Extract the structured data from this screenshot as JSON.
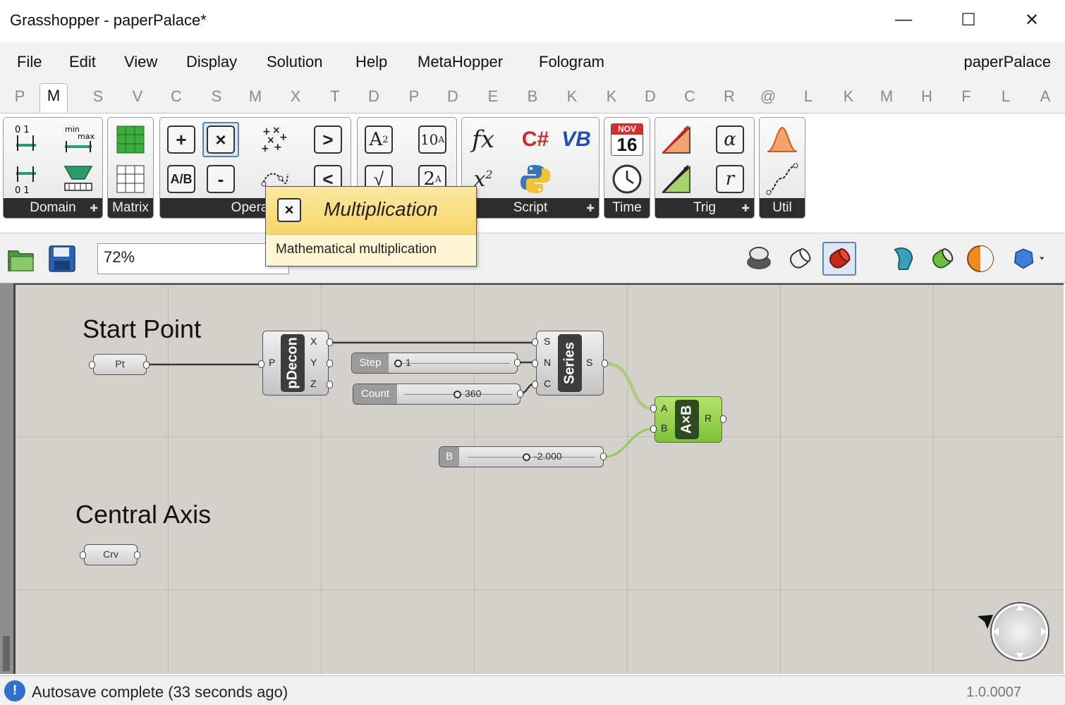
{
  "window": {
    "title": "Grasshopper - paperPalace*",
    "minimize": "—",
    "maximize": "☐",
    "close": "✕"
  },
  "menu": {
    "items": [
      "File",
      "Edit",
      "View",
      "Display",
      "Solution",
      "Help",
      "MetaHopper",
      "Fologram"
    ],
    "document": "paperPalace"
  },
  "tabs": [
    "P",
    "M",
    "S",
    "V",
    "C",
    "S",
    "M",
    "X",
    "T",
    "D",
    "P",
    "D",
    "E",
    "B",
    "K",
    "K",
    "D",
    "C",
    "R",
    "@",
    "L",
    "K",
    "M",
    "H",
    "F",
    "L",
    "A"
  ],
  "active_tab": "M",
  "ribbon": {
    "panels": [
      "Domain",
      "Matrix",
      "Operators",
      "Script",
      "Time",
      "Trig",
      "Util"
    ],
    "panel_labels_visible": [
      "Domain",
      "Matrix",
      "Operato",
      "Script",
      "Time",
      "Trig",
      "Util"
    ],
    "domain_icons": {
      "a": "0 1",
      "b": "min max",
      "c": "0 1"
    },
    "script_icons": {
      "fx": "fx",
      "x2": "x",
      "x2sup": "2",
      "cs": "C#",
      "vb": "VB"
    },
    "time_icons": {
      "month": "NOV",
      "day": "16"
    },
    "operators_icons": {
      "add": "+",
      "mul": "×",
      "div": "A/B",
      "sub": "-",
      "gt": ">",
      "lt": "<",
      "pow": "A",
      "sqrt": "√",
      "pow10": "10",
      "pow2": "2"
    },
    "trig_icons": {
      "alpha": "α",
      "r": "r"
    }
  },
  "tooltip": {
    "name": "Multiplication",
    "description": "Mathematical multiplication",
    "icon": "×"
  },
  "toolbar": {
    "zoom": "72%",
    "icons": [
      "open-icon",
      "save-icon",
      "preview-off-icon",
      "wireframe-icon",
      "shaded-icon",
      "preview-selected-icon",
      "doc-preview-icon",
      "material-icon",
      "sphere-icon"
    ]
  },
  "canvas": {
    "groups": [
      "Start Point",
      "Central Axis"
    ],
    "components": {
      "pt": {
        "label": "Pt"
      },
      "crv": {
        "label": "Crv"
      },
      "pdecon": {
        "name": "pDecon",
        "input": "P",
        "outputs": [
          "X",
          "Y",
          "Z"
        ]
      },
      "series": {
        "name": "Series",
        "inputs": [
          "S",
          "N",
          "C"
        ],
        "output": "S"
      },
      "multiply": {
        "name": "A×B",
        "inputs": [
          "A",
          "B"
        ],
        "output": "R"
      }
    },
    "sliders": [
      {
        "name": "Step",
        "value": "1"
      },
      {
        "name": "Count",
        "value": "360"
      },
      {
        "name": "B",
        "value": "-2.000"
      }
    ]
  },
  "status": {
    "message": "Autosave complete (33 seconds ago)",
    "version": "1.0.0007",
    "icon": "info-icon"
  },
  "colors": {
    "canvas": "#d4d1cc",
    "selected_component": "#8bc840",
    "tooltip_header": "#f7d56c",
    "status_icon": "#2f6fce"
  }
}
